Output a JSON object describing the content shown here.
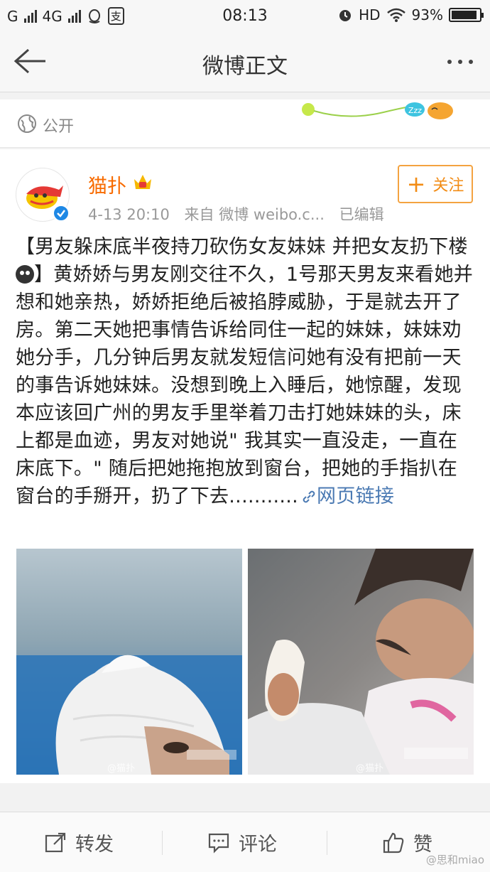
{
  "status_bar": {
    "carrier1": "G",
    "carrier2": "4G",
    "app_icon_label": "支",
    "time": "08:13",
    "hd": "HD",
    "battery": "93%",
    "battery_level": 0.93
  },
  "nav": {
    "title": "微博正文"
  },
  "visibility": {
    "label": "公开",
    "deco_text": "Zzz"
  },
  "post": {
    "username": "猫扑",
    "timestamp": "4-13 20:10",
    "source": "来自 微博 weibo.c...",
    "edited": "已编辑",
    "follow_label": "关注",
    "text_part1": "【男友躲床底半夜持刀砍伤女友妹妹 并把女友扔下楼",
    "text_part2": "】黄娇娇与男友刚交往不久，1号那天男友来看她并想和她亲热，娇娇拒绝后被掐脖威胁，于是就去开了房。第二天她把事情告诉给同住一起的妹妹，妹妹劝她分手，几分钟后男友就发短信问她有没有把前一天的事告诉她妹妹。没想到晚上入睡后，她惊醒，发现本应该回广州的男友手里举着刀击打她妹妹的头，床上都是血迹，男友对她说\" 我其实一直没走，一直在床底下。\" 随后把她拖抱放到窗台，把她的手指扒在窗台的手掰开，扔了下去...........",
    "link_label": "网页链接",
    "photo_watermark_1": "@猫扑",
    "photo_watermark_2": "@猫扑"
  },
  "bottom_bar": {
    "repost": "转发",
    "comment": "评论",
    "like": "赞",
    "watermark": "@思和miao"
  },
  "colors": {
    "accent_orange": "#f86b00",
    "link_blue": "#4b7ab3",
    "verified_blue": "#1e88e5"
  }
}
